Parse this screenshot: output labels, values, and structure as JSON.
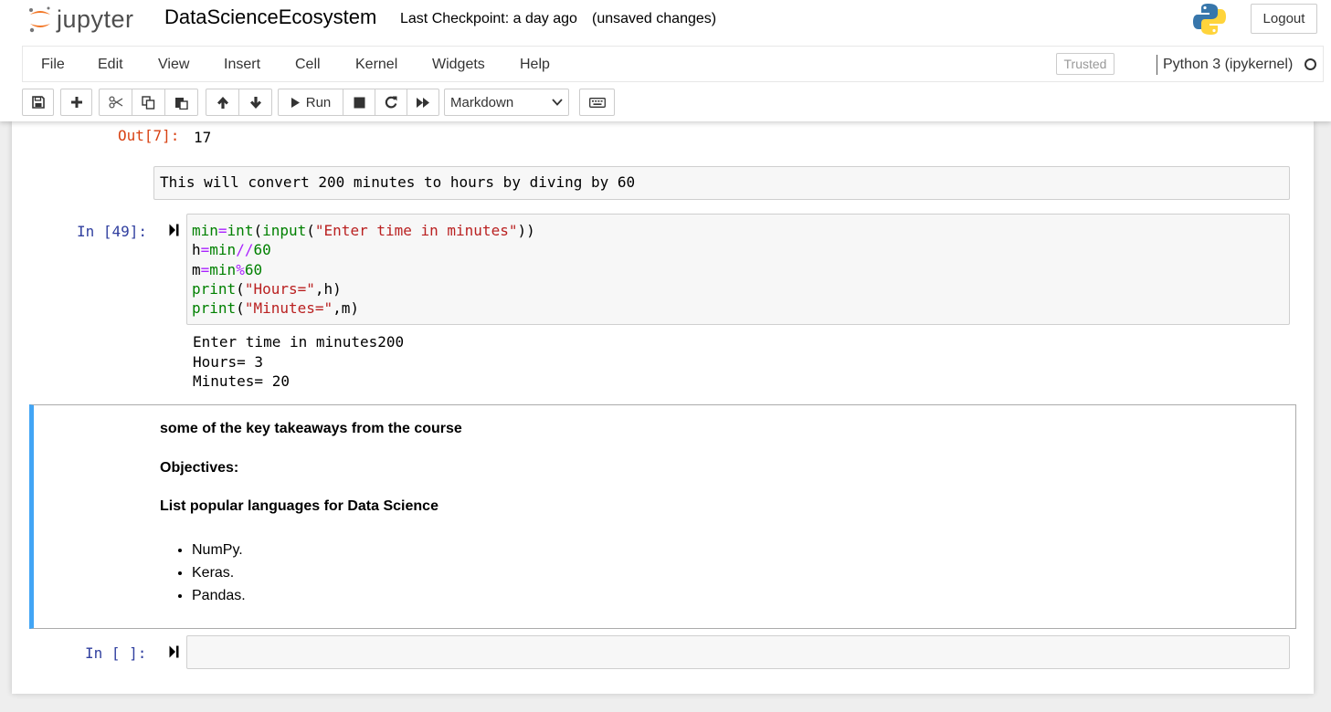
{
  "header": {
    "logo_text": "jupyter",
    "notebook_title": "DataScienceEcosystem",
    "checkpoint": "Last Checkpoint: a day ago",
    "unsaved": "(unsaved changes)",
    "logout_label": "Logout"
  },
  "menubar": {
    "items": [
      "File",
      "Edit",
      "View",
      "Insert",
      "Cell",
      "Kernel",
      "Widgets",
      "Help"
    ],
    "trusted_label": "Trusted",
    "kernel_name": "Python 3 (ipykernel)"
  },
  "toolbar": {
    "run_label": "Run",
    "cell_type": "Markdown"
  },
  "cells": {
    "out7": {
      "prompt": "Out[7]:",
      "value": "17"
    },
    "md_edit": {
      "text": "This will convert 200 minutes to hours by diving by 60"
    },
    "code49": {
      "prompt": "In [49]:",
      "lines": [
        "min=int(input(\"Enter time in minutes\"))",
        "h=min//60",
        "m=min%60",
        "print(\"Hours=\",h)",
        "print(\"Minutes=\",m)"
      ],
      "output": [
        "Enter time in minutes200",
        "Hours= 3",
        "Minutes= 20"
      ]
    },
    "md_rendered": {
      "line1": "some of the key takeaways from the course",
      "line2": "Objectives:",
      "line3": "List popular languages for Data Science",
      "list": [
        "NumPy.",
        "Keras.",
        "Pandas."
      ]
    },
    "empty": {
      "prompt": "In [ ]:"
    }
  },
  "colors": {
    "accent_selected": "#42a5f5",
    "prompt_in": "#303f9f",
    "prompt_out": "#d84315",
    "jupyter_orange": "#f37726"
  },
  "icons": [
    "jupyter-logo-icon",
    "python-logo-icon",
    "save-icon",
    "plus-icon",
    "cut-icon",
    "copy-icon",
    "paste-icon",
    "arrow-up-icon",
    "arrow-down-icon",
    "play-icon",
    "stop-icon",
    "restart-icon",
    "fast-forward-icon",
    "chevron-down-icon",
    "keyboard-icon",
    "kernel-status-icon",
    "run-cell-icon"
  ]
}
